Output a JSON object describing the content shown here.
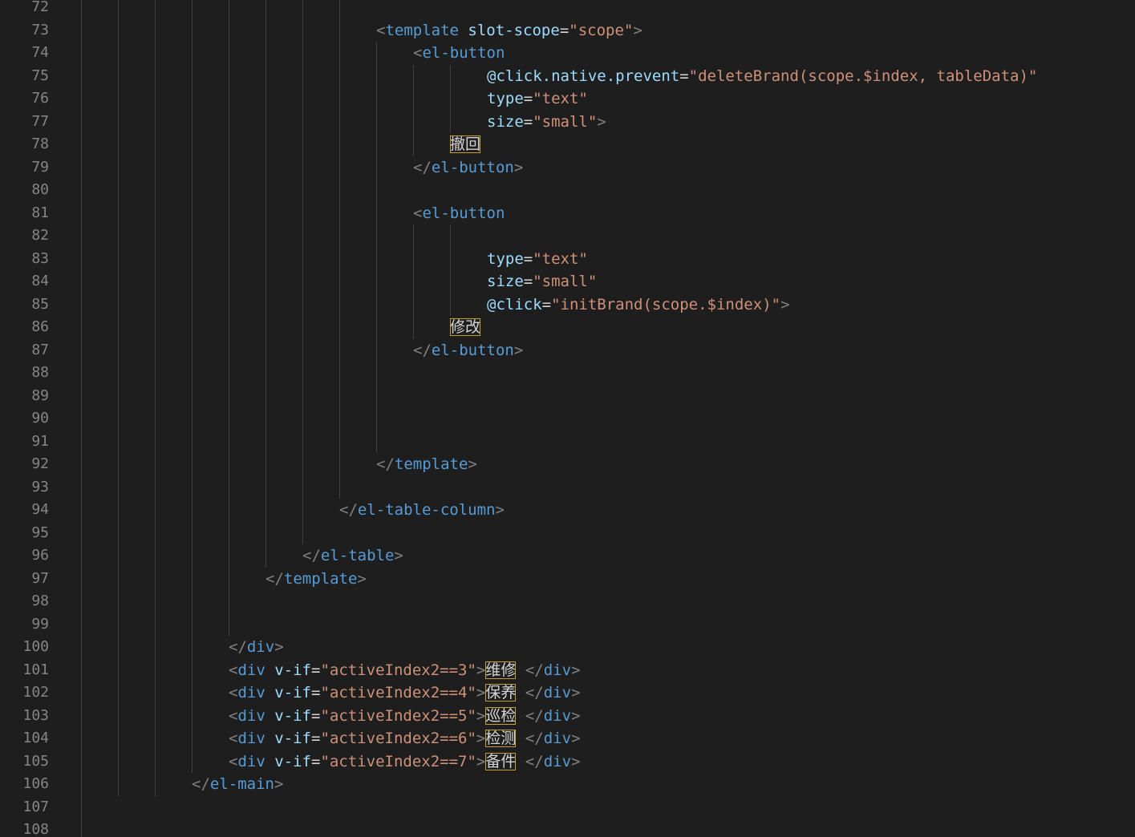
{
  "editor": {
    "lines": [
      {
        "num": "72",
        "indent": 0,
        "tokens": []
      },
      {
        "num": "73",
        "indent": 9,
        "tokens": [
          {
            "k": "p",
            "v": "<"
          },
          {
            "k": "t",
            "v": "template"
          },
          {
            "k": "o",
            "v": " "
          },
          {
            "k": "a",
            "v": "slot-scope"
          },
          {
            "k": "o",
            "v": "="
          },
          {
            "k": "s",
            "v": "\"scope\""
          },
          {
            "k": "p",
            "v": ">"
          }
        ]
      },
      {
        "num": "74",
        "indent": 10,
        "tokens": [
          {
            "k": "p",
            "v": "<"
          },
          {
            "k": "t",
            "v": "el-button"
          }
        ]
      },
      {
        "num": "75",
        "indent": 12,
        "tokens": [
          {
            "k": "a",
            "v": "@click.native.prevent"
          },
          {
            "k": "o",
            "v": "="
          },
          {
            "k": "s",
            "v": "\"deleteBrand(scope.$index, tableData)\""
          }
        ]
      },
      {
        "num": "76",
        "indent": 12,
        "tokens": [
          {
            "k": "a",
            "v": "type"
          },
          {
            "k": "o",
            "v": "="
          },
          {
            "k": "s",
            "v": "\"text\""
          }
        ]
      },
      {
        "num": "77",
        "indent": 12,
        "tokens": [
          {
            "k": "a",
            "v": "size"
          },
          {
            "k": "o",
            "v": "="
          },
          {
            "k": "s",
            "v": "\"small\""
          },
          {
            "k": "p",
            "v": ">"
          }
        ]
      },
      {
        "num": "78",
        "indent": 11,
        "tokens": [
          {
            "k": "x",
            "v": "撤回",
            "hl": true
          }
        ]
      },
      {
        "num": "79",
        "indent": 10,
        "tokens": [
          {
            "k": "p",
            "v": "</"
          },
          {
            "k": "t",
            "v": "el-button"
          },
          {
            "k": "p",
            "v": ">"
          }
        ]
      },
      {
        "num": "80",
        "indent": 0,
        "tokens": []
      },
      {
        "num": "81",
        "indent": 10,
        "tokens": [
          {
            "k": "p",
            "v": "<"
          },
          {
            "k": "t",
            "v": "el-button"
          }
        ]
      },
      {
        "num": "82",
        "indent": 0,
        "tokens": []
      },
      {
        "num": "83",
        "indent": 12,
        "tokens": [
          {
            "k": "a",
            "v": "type"
          },
          {
            "k": "o",
            "v": "="
          },
          {
            "k": "s",
            "v": "\"text\""
          }
        ]
      },
      {
        "num": "84",
        "indent": 12,
        "tokens": [
          {
            "k": "a",
            "v": "size"
          },
          {
            "k": "o",
            "v": "="
          },
          {
            "k": "s",
            "v": "\"small\""
          }
        ]
      },
      {
        "num": "85",
        "indent": 12,
        "tokens": [
          {
            "k": "a",
            "v": "@click"
          },
          {
            "k": "o",
            "v": "="
          },
          {
            "k": "s",
            "v": "\"initBrand(scope.$index)\""
          },
          {
            "k": "p",
            "v": ">"
          }
        ]
      },
      {
        "num": "86",
        "indent": 11,
        "tokens": [
          {
            "k": "x",
            "v": "修改",
            "hl": true
          }
        ]
      },
      {
        "num": "87",
        "indent": 10,
        "tokens": [
          {
            "k": "p",
            "v": "</"
          },
          {
            "k": "t",
            "v": "el-button"
          },
          {
            "k": "p",
            "v": ">"
          }
        ]
      },
      {
        "num": "88",
        "indent": 0,
        "tokens": []
      },
      {
        "num": "89",
        "indent": 0,
        "tokens": []
      },
      {
        "num": "90",
        "indent": 0,
        "tokens": []
      },
      {
        "num": "91",
        "indent": 0,
        "tokens": []
      },
      {
        "num": "92",
        "indent": 9,
        "tokens": [
          {
            "k": "p",
            "v": "</"
          },
          {
            "k": "t",
            "v": "template"
          },
          {
            "k": "p",
            "v": ">"
          }
        ]
      },
      {
        "num": "93",
        "indent": 0,
        "tokens": []
      },
      {
        "num": "94",
        "indent": 8,
        "tokens": [
          {
            "k": "p",
            "v": "</"
          },
          {
            "k": "t",
            "v": "el-table-column"
          },
          {
            "k": "p",
            "v": ">"
          }
        ]
      },
      {
        "num": "95",
        "indent": 0,
        "tokens": []
      },
      {
        "num": "96",
        "indent": 7,
        "tokens": [
          {
            "k": "p",
            "v": "</"
          },
          {
            "k": "t",
            "v": "el-table"
          },
          {
            "k": "p",
            "v": ">"
          }
        ]
      },
      {
        "num": "97",
        "indent": 6,
        "tokens": [
          {
            "k": "p",
            "v": "</"
          },
          {
            "k": "t",
            "v": "template"
          },
          {
            "k": "p",
            "v": ">"
          }
        ]
      },
      {
        "num": "98",
        "indent": 0,
        "tokens": []
      },
      {
        "num": "99",
        "indent": 0,
        "tokens": []
      },
      {
        "num": "100",
        "indent": 5,
        "tokens": [
          {
            "k": "p",
            "v": "</"
          },
          {
            "k": "t",
            "v": "div"
          },
          {
            "k": "p",
            "v": ">"
          }
        ]
      },
      {
        "num": "101",
        "indent": 5,
        "tokens": [
          {
            "k": "p",
            "v": "<"
          },
          {
            "k": "t",
            "v": "div"
          },
          {
            "k": "o",
            "v": " "
          },
          {
            "k": "a",
            "v": "v-if"
          },
          {
            "k": "o",
            "v": "="
          },
          {
            "k": "s",
            "v": "\"activeIndex2==3\""
          },
          {
            "k": "p",
            "v": ">"
          },
          {
            "k": "x",
            "v": "维修",
            "hl": true
          },
          {
            "k": "o",
            "v": " "
          },
          {
            "k": "p",
            "v": "</"
          },
          {
            "k": "t",
            "v": "div"
          },
          {
            "k": "p",
            "v": ">"
          }
        ]
      },
      {
        "num": "102",
        "indent": 5,
        "tokens": [
          {
            "k": "p",
            "v": "<"
          },
          {
            "k": "t",
            "v": "div"
          },
          {
            "k": "o",
            "v": " "
          },
          {
            "k": "a",
            "v": "v-if"
          },
          {
            "k": "o",
            "v": "="
          },
          {
            "k": "s",
            "v": "\"activeIndex2==4\""
          },
          {
            "k": "p",
            "v": ">"
          },
          {
            "k": "x",
            "v": "保养",
            "hl": true
          },
          {
            "k": "o",
            "v": " "
          },
          {
            "k": "p",
            "v": "</"
          },
          {
            "k": "t",
            "v": "div"
          },
          {
            "k": "p",
            "v": ">"
          }
        ]
      },
      {
        "num": "103",
        "indent": 5,
        "tokens": [
          {
            "k": "p",
            "v": "<"
          },
          {
            "k": "t",
            "v": "div"
          },
          {
            "k": "o",
            "v": " "
          },
          {
            "k": "a",
            "v": "v-if"
          },
          {
            "k": "o",
            "v": "="
          },
          {
            "k": "s",
            "v": "\"activeIndex2==5\""
          },
          {
            "k": "p",
            "v": ">"
          },
          {
            "k": "x",
            "v": "巡检",
            "hl": true
          },
          {
            "k": "o",
            "v": " "
          },
          {
            "k": "p",
            "v": "</"
          },
          {
            "k": "t",
            "v": "div"
          },
          {
            "k": "p",
            "v": ">"
          }
        ]
      },
      {
        "num": "104",
        "indent": 5,
        "tokens": [
          {
            "k": "p",
            "v": "<"
          },
          {
            "k": "t",
            "v": "div"
          },
          {
            "k": "o",
            "v": " "
          },
          {
            "k": "a",
            "v": "v-if"
          },
          {
            "k": "o",
            "v": "="
          },
          {
            "k": "s",
            "v": "\"activeIndex2==6\""
          },
          {
            "k": "p",
            "v": ">"
          },
          {
            "k": "x",
            "v": "检测",
            "hl": true
          },
          {
            "k": "o",
            "v": " "
          },
          {
            "k": "p",
            "v": "</"
          },
          {
            "k": "t",
            "v": "div"
          },
          {
            "k": "p",
            "v": ">"
          }
        ]
      },
      {
        "num": "105",
        "indent": 5,
        "tokens": [
          {
            "k": "p",
            "v": "<"
          },
          {
            "k": "t",
            "v": "div"
          },
          {
            "k": "o",
            "v": " "
          },
          {
            "k": "a",
            "v": "v-if"
          },
          {
            "k": "o",
            "v": "="
          },
          {
            "k": "s",
            "v": "\"activeIndex2==7\""
          },
          {
            "k": "p",
            "v": ">"
          },
          {
            "k": "x",
            "v": "备件",
            "hl": true
          },
          {
            "k": "o",
            "v": " "
          },
          {
            "k": "p",
            "v": "</"
          },
          {
            "k": "t",
            "v": "div"
          },
          {
            "k": "p",
            "v": ">"
          }
        ]
      },
      {
        "num": "106",
        "indent": 4,
        "tokens": [
          {
            "k": "p",
            "v": "</"
          },
          {
            "k": "t",
            "v": "el-main"
          },
          {
            "k": "p",
            "v": ">"
          }
        ]
      },
      {
        "num": "107",
        "indent": 0,
        "tokens": []
      },
      {
        "num": "108",
        "indent": 0,
        "tokens": []
      }
    ]
  },
  "theme": {
    "background": "#1e1e1e",
    "line_number": "#858585",
    "tag_punctuation": "#808080",
    "tag_name": "#569cd6",
    "attribute": "#9cdcfe",
    "string": "#ce9178",
    "text": "#d4d4d4",
    "highlight_border": "#c5a02c"
  }
}
